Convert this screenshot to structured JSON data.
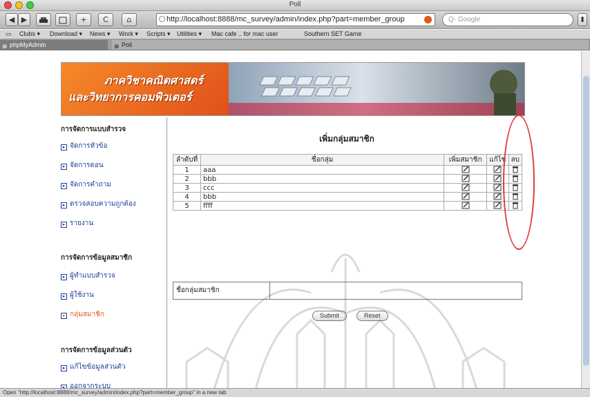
{
  "browser": {
    "window_title": "Poll",
    "url": "http://localhost:8888/mc_survey/admin/index.php?part=member_group",
    "search_placeholder": "Q- Google",
    "nav_buttons": [
      "◀",
      "▶",
      "",
      "",
      "+",
      "C",
      "⌂"
    ],
    "bookmarks": [
      "Clubs ▾",
      "Download ▾",
      "News ▾",
      "Work ▾",
      "Scripts ▾",
      "Utilities ▾",
      "Mac cafe .. for mac user",
      "Southern SET Game"
    ],
    "tabs": [
      {
        "label": "phpMyAdmin"
      },
      {
        "label": "Poll"
      }
    ],
    "status": "Open \"http://localhost:8888/mc_survey/admin/index.php?part=member_group\" in a new tab"
  },
  "banner": {
    "line1": "ภาควิชาคณิตศาสตร์",
    "line2": "และวิทยาการคอมพิวเตอร์"
  },
  "sidebar": {
    "sections": [
      {
        "heading": "การจัดการแบบสำรวจ",
        "items": [
          "จัดการหัวข้อ",
          "จัดการตอน",
          "จัดการคำถาม",
          "ตรวจสอบความถูกต้อง",
          "รายงาน"
        ]
      },
      {
        "heading": "การจัดการข้อมูลสมาชิก",
        "items": [
          "ผู้ทำแบบสำรวจ",
          "ผู้ใช้งาน",
          "กลุ่มสมาชิก"
        ]
      },
      {
        "heading": "การจัดการข้อมูลส่วนตัว",
        "items": [
          "แก้ไขข้อมูลส่วนตัว",
          "ออกจากระบบ"
        ]
      }
    ],
    "active_item": "กลุ่มสมาชิก"
  },
  "main": {
    "title": "เพิ่มกลุ่มสมาชิก",
    "columns": [
      "ลำดับที่",
      "ชื่อกลุ่ม",
      "เพิ่มสมาชิก",
      "แก้ไข",
      "ลบ"
    ],
    "rows": [
      {
        "no": "1",
        "name": "aaa"
      },
      {
        "no": "2",
        "name": "bbb"
      },
      {
        "no": "3",
        "name": "ccc"
      },
      {
        "no": "4",
        "name": "bbb"
      },
      {
        "no": "5",
        "name": "ffff"
      }
    ],
    "form_label": "ชื่อกลุ่มสมาชิก",
    "form_value": "",
    "submit_label": "Submit",
    "reset_label": "Reset"
  },
  "colors": {
    "accent": "#e05a1a",
    "link": "#1a3f9a",
    "annotation": "#e23a3a"
  }
}
